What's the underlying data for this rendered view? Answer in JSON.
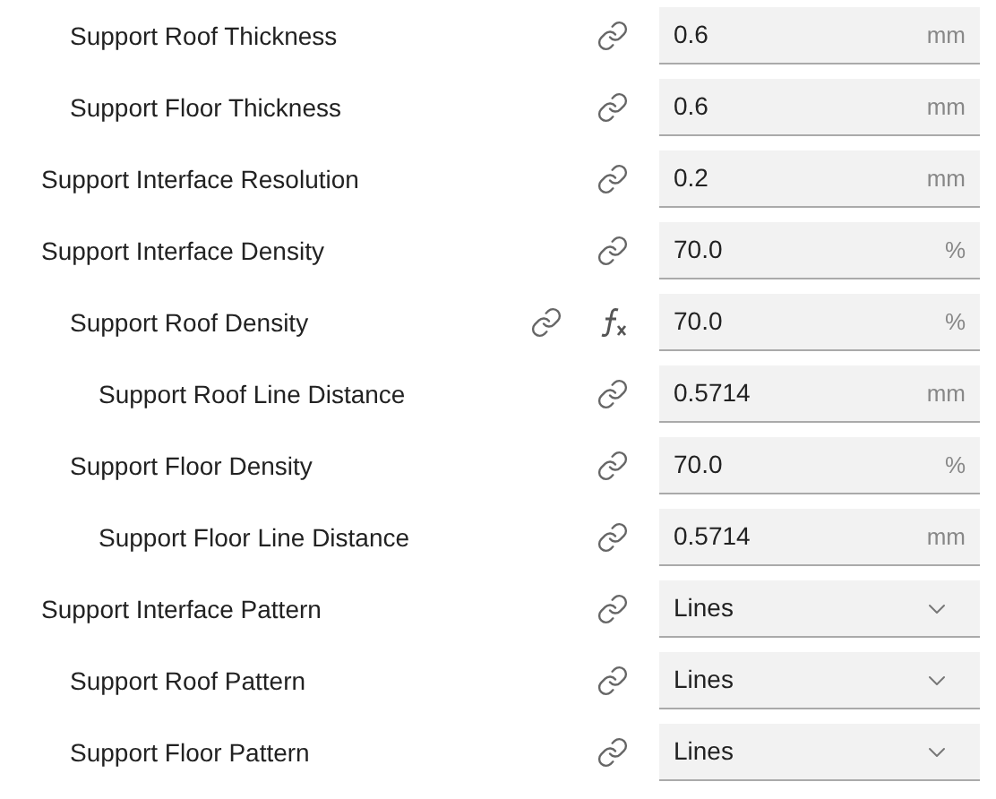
{
  "settings": [
    {
      "children": [
        {
          "label": "Support Roof Thickness",
          "formula": false,
          "kind": "number",
          "value": "0.6",
          "unit": "mm"
        },
        {
          "label": "Support Floor Thickness",
          "formula": false,
          "kind": "number",
          "value": "0.6",
          "unit": "mm"
        }
      ]
    },
    {
      "label": "Support Interface Resolution",
      "formula": false,
      "kind": "number",
      "value": "0.2",
      "unit": "mm"
    },
    {
      "label": "Support Interface Density",
      "formula": false,
      "kind": "number",
      "value": "70.0",
      "unit": "%",
      "children": [
        {
          "label": "Support Roof Density",
          "formula": true,
          "kind": "number",
          "value": "70.0",
          "unit": "%",
          "children": [
            {
              "label": "Support Roof Line Distance",
              "formula": false,
              "kind": "number",
              "value": "0.5714",
              "unit": "mm"
            }
          ]
        },
        {
          "label": "Support Floor Density",
          "formula": false,
          "kind": "number",
          "value": "70.0",
          "unit": "%",
          "children": [
            {
              "label": "Support Floor Line Distance",
              "formula": false,
              "kind": "number",
              "value": "0.5714",
              "unit": "mm"
            }
          ]
        }
      ]
    },
    {
      "label": "Support Interface Pattern",
      "formula": false,
      "kind": "dropdown",
      "value": "Lines",
      "children": [
        {
          "label": "Support Roof Pattern",
          "formula": false,
          "kind": "dropdown",
          "value": "Lines"
        },
        {
          "label": "Support Floor Pattern",
          "formula": false,
          "kind": "dropdown",
          "value": "Lines"
        }
      ]
    }
  ]
}
